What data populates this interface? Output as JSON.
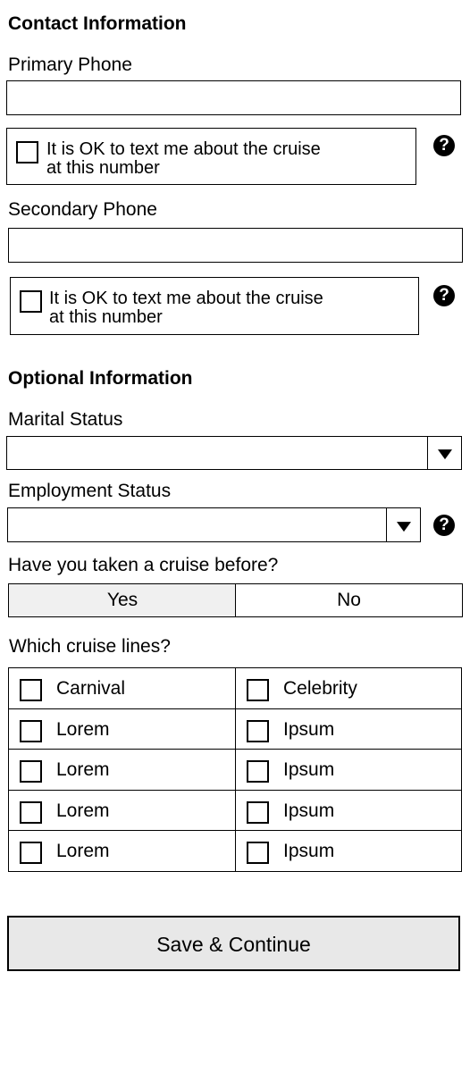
{
  "contact": {
    "heading": "Contact Information",
    "primary_phone": {
      "label": "Primary Phone",
      "value": "",
      "sms_label_line1": "It is OK to text me about the cruise",
      "sms_label_line2": "at this number",
      "help": "?"
    },
    "secondary_phone": {
      "label": "Secondary Phone",
      "value": "",
      "sms_label_line1": "It is OK to text me about the cruise",
      "sms_label_line2": "at this number",
      "help": "?"
    }
  },
  "optional": {
    "heading": "Optional Information",
    "marital_status": {
      "label": "Marital Status",
      "value": ""
    },
    "employment_status": {
      "label": "Employment Status",
      "value": "",
      "help": "?"
    },
    "cruised_before": {
      "label": "Have you taken a cruise before?",
      "options": [
        "Yes",
        "No"
      ],
      "selected": "Yes"
    },
    "cruise_lines": {
      "label": "Which cruise lines?",
      "items": [
        "Carnival",
        "Celebrity",
        "Lorem",
        "Ipsum",
        "Lorem",
        "Ipsum",
        "Lorem",
        "Ipsum",
        "Lorem",
        "Ipsum"
      ]
    }
  },
  "actions": {
    "save_label": "Save & Continue"
  },
  "colors": {
    "selected_segment": "#f0f0f0",
    "save_button_bg": "#e8e8e8"
  }
}
